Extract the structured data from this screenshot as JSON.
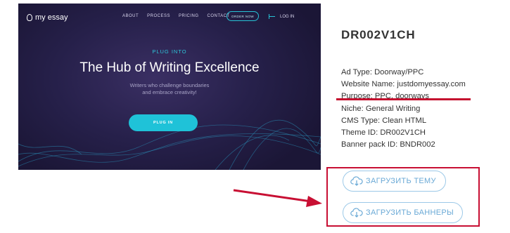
{
  "preview": {
    "logo_text": "my essay",
    "menu": [
      "ABOUT",
      "PROCESS",
      "PRICING",
      "CONTACT"
    ],
    "order_button": "ORDER NOW",
    "login": "LOG IN",
    "kicker": "PLUG INTO",
    "headline": "The Hub of Writing Excellence",
    "subline_1": "Writers who challenge boundaries",
    "subline_2": "and embrace creativity!",
    "cta": "PLUG IN",
    "accent_color": "#1fc2d8"
  },
  "product": {
    "title": "DR002V1CH",
    "properties": [
      {
        "label": "Ad Type:",
        "value": "Doorway/PPC"
      },
      {
        "label": "Website Name:",
        "value": "justdomyessay.com"
      },
      {
        "label": "Purpose:",
        "value": "PPC, doorways"
      },
      {
        "label": "Niche:",
        "value": "General Writing"
      },
      {
        "label": "CMS Type:",
        "value": "Clean HTML"
      },
      {
        "label": "Theme ID:",
        "value": "DR002V1CH"
      },
      {
        "label": "Banner pack ID:",
        "value": "BNDR002"
      }
    ]
  },
  "actions": {
    "download_theme": "ЗАГРУЗИТЬ ТЕМУ",
    "download_banners": "ЗАГРУЗИТЬ БАННЕРЫ",
    "icon": "cloud-download-icon",
    "highlight_color": "#c80f33"
  }
}
